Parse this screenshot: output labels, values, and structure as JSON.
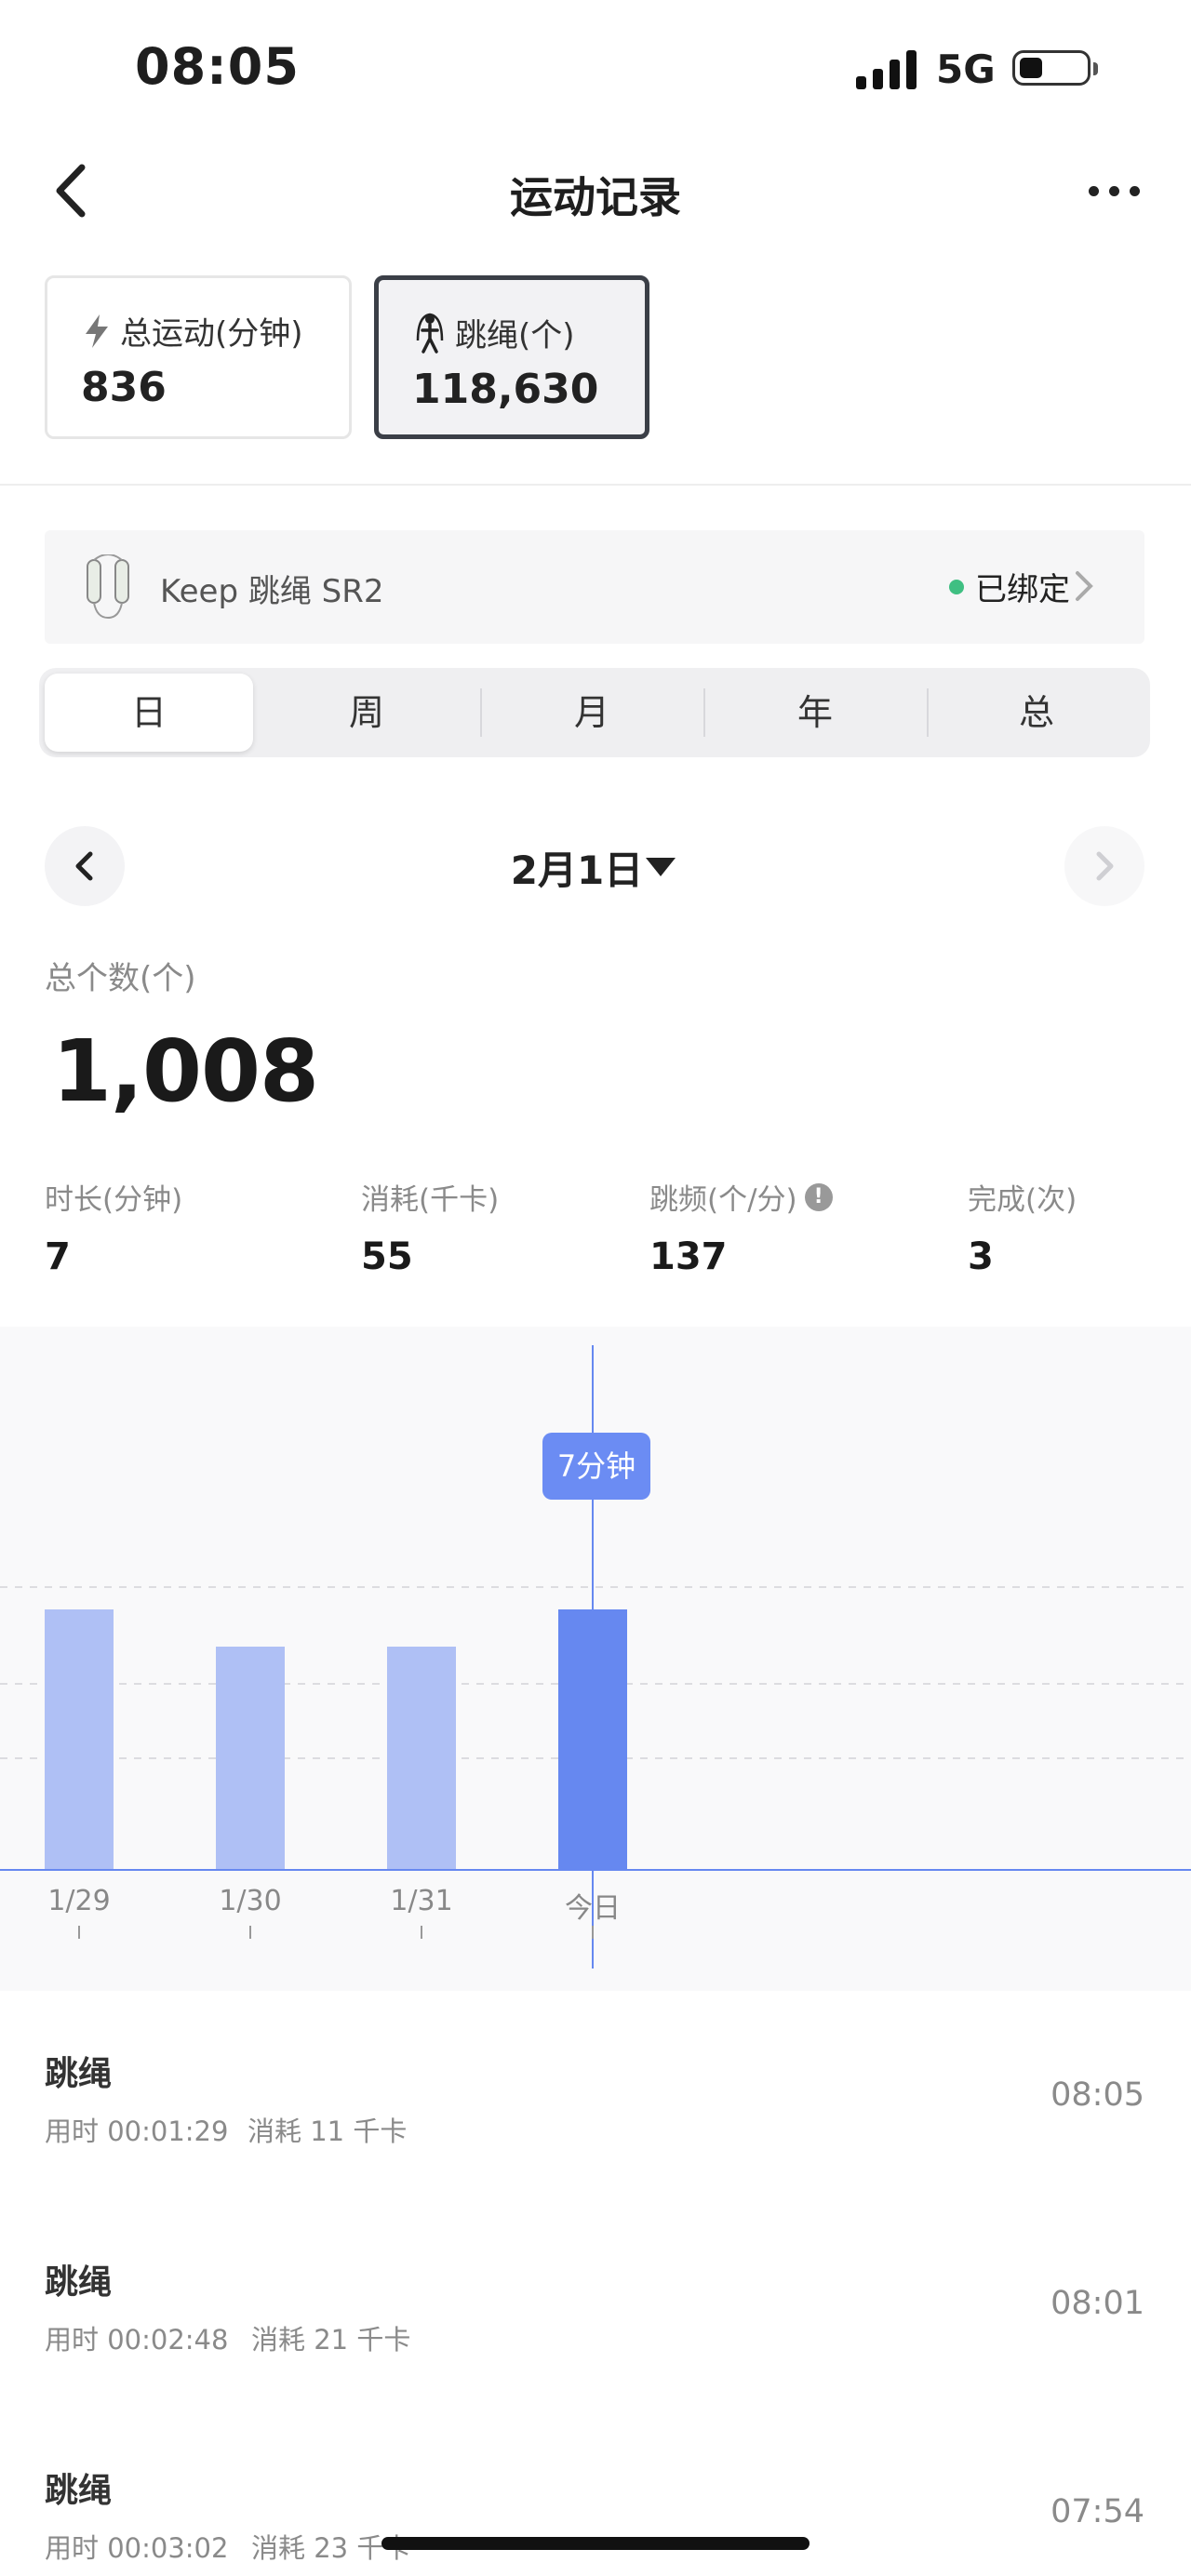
{
  "status_bar": {
    "time": "08:05",
    "network": "5G"
  },
  "nav": {
    "title": "运动记录"
  },
  "stats": [
    {
      "label": "总运动(分钟)",
      "value": "836",
      "icon": "lightning-icon"
    },
    {
      "label": "跳绳(个)",
      "value": "118,630",
      "icon": "jump-rope-icon"
    }
  ],
  "device": {
    "name": "Keep 跳绳 SR2",
    "status": "已绑定"
  },
  "segments": [
    "日",
    "周",
    "月",
    "年",
    "总"
  ],
  "date": {
    "label": "2月1日"
  },
  "total": {
    "label": "总个数(个)",
    "value": "1,008"
  },
  "metrics": [
    {
      "label": "时长(分钟)",
      "value": "7"
    },
    {
      "label": "消耗(千卡)",
      "value": "55"
    },
    {
      "label": "跳频(个/分)",
      "value": "137"
    },
    {
      "label": "完成(次)",
      "value": "3"
    }
  ],
  "chart_data": {
    "type": "bar",
    "categories": [
      "1/29",
      "1/30",
      "1/31",
      "今日"
    ],
    "values": [
      7,
      6,
      6,
      7
    ],
    "unit": "分钟",
    "selected_index": 3,
    "tooltip": "7分钟",
    "colors": {
      "bar": "#afc0f5",
      "selected": "#6688f0",
      "line": "#6688f0"
    }
  },
  "records": [
    {
      "title": "跳绳",
      "duration": "用时 00:01:29",
      "calories": "消耗 11 千卡",
      "time": "08:05"
    },
    {
      "title": "跳绳",
      "duration": "用时 00:02:48",
      "calories": "消耗 21 千卡",
      "time": "08:01"
    },
    {
      "title": "跳绳",
      "duration": "用时 00:03:02",
      "calories": "消耗 23 千卡",
      "time": "07:54"
    }
  ]
}
